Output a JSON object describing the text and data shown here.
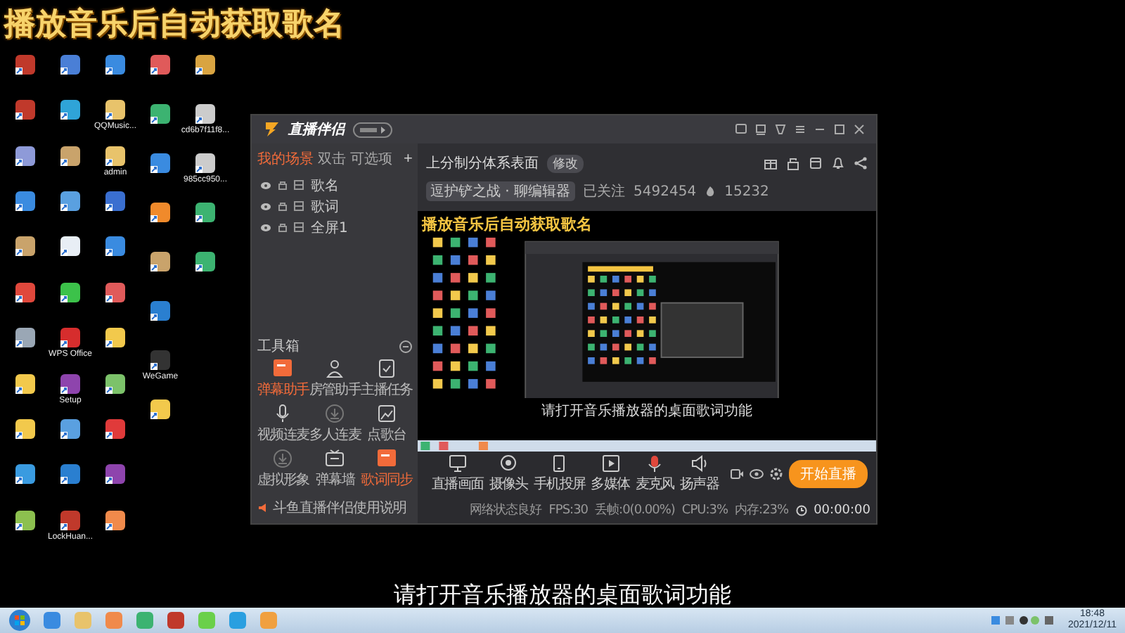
{
  "overlay_title": "播放音乐后自动获取歌名",
  "desktop_columns": [
    [
      {
        "color": "#c0392b"
      },
      {
        "color": "#c0392b"
      },
      {
        "color": "#8e9ad8"
      },
      {
        "color": "#3a8be0"
      },
      {
        "color": "#c9a36b"
      },
      {
        "color": "#e0483c"
      },
      {
        "color": "#9aa7b5"
      },
      {
        "color": "#f2c94c"
      },
      {
        "color": "#f2c94c"
      },
      {
        "color": "#3a9be0"
      },
      {
        "color": "#8cc04f"
      }
    ],
    [
      {
        "color": "#4a7fd6"
      },
      {
        "color": "#2fa4d8"
      },
      {
        "color": "#c9a36b"
      },
      {
        "color": "#5aa0e0"
      },
      {
        "color": "#e8eef5"
      },
      {
        "color": "#3cc24a"
      },
      {
        "color": "#d62d2d",
        "label": "WPS Office"
      },
      {
        "color": "#8e44ad",
        "label": "Setup"
      },
      {
        "color": "#5aa0e0"
      },
      {
        "color": "#2a7fd0"
      },
      {
        "color": "#c0392b",
        "label": "LockHuan..."
      }
    ],
    [
      {
        "color": "#3a8be0"
      },
      {
        "color": "#e8c36b",
        "label": "QQMusic..."
      },
      {
        "color": "#e8c36b",
        "label": "admin"
      },
      {
        "color": "#3a6fd0"
      },
      {
        "color": "#3a8be0"
      },
      {
        "color": "#e05a5a"
      },
      {
        "color": "#f2c94c"
      },
      {
        "color": "#7cc26a"
      },
      {
        "color": "#e03a3a"
      },
      {
        "color": "#8e44ad"
      },
      {
        "color": "#f08a4b"
      }
    ],
    [
      {
        "color": "#e05a5a"
      },
      {
        "color": "#3cb371"
      },
      {
        "color": "#3a8be0"
      },
      {
        "color": "#f08a2b"
      },
      {
        "color": "#c9a36b"
      },
      {
        "color": "#2a7fd0"
      },
      {
        "color": "#333333",
        "label": "WeGame"
      },
      {
        "color": "#f2c94c"
      }
    ],
    [
      {
        "color": "#d9a441"
      },
      {
        "color": "#cccccc",
        "label": "cd6b7f11f8..."
      },
      {
        "color": "#cccccc",
        "label": "985cc950..."
      },
      {
        "color": "#3cb371"
      },
      {
        "color": "#3cb371"
      }
    ]
  ],
  "window": {
    "logo": "直播伴侣",
    "scene_tabs": [
      {
        "label": "我的场景",
        "selected": true
      },
      {
        "label": "双击",
        "selected": false
      },
      {
        "label": "可选项",
        "selected": false
      }
    ],
    "add_button": "+",
    "scenes": [
      {
        "label": "歌名"
      },
      {
        "label": "歌词"
      },
      {
        "label": "全屏1"
      }
    ],
    "toolbox_title": "工具箱",
    "tools": [
      {
        "label": "弹幕助手",
        "kind": "screen",
        "highlight": true
      },
      {
        "label": "房管助手",
        "kind": "person",
        "highlight": false
      },
      {
        "label": "主播任务",
        "kind": "clipboard",
        "highlight": false
      },
      {
        "label": "视频连麦",
        "kind": "mic",
        "highlight": false
      },
      {
        "label": "多人连麦",
        "kind": "download",
        "highlight": false
      },
      {
        "label": "点歌台",
        "kind": "image",
        "highlight": false
      },
      {
        "label": "虚拟形象",
        "kind": "download",
        "highlight": false
      },
      {
        "label": "弹幕墙",
        "kind": "tv",
        "highlight": false
      },
      {
        "label": "歌词同步",
        "kind": "screen",
        "highlight": true
      }
    ],
    "notice": "斗鱼直播伴侣使用说明",
    "room_title": "上分制分体系表面",
    "room_edit": "修改",
    "room_tag": "逗护铲之战 · 聊编辑器",
    "followers_label": "已关注",
    "followers": "5492454",
    "hot": "15232",
    "preview": {
      "title": "播放音乐后自动获取歌名",
      "caption": "请打开音乐播放器的桌面歌词功能"
    },
    "controls": [
      {
        "label": "直播画面",
        "kind": "screen"
      },
      {
        "label": "摄像头",
        "kind": "camera"
      },
      {
        "label": "手机投屏",
        "kind": "phone"
      },
      {
        "label": "多媒体",
        "kind": "media"
      },
      {
        "label": "麦克风",
        "kind": "mic"
      },
      {
        "label": "扬声器",
        "kind": "speaker"
      }
    ],
    "start_button": "开始直播",
    "status": [
      "网络状态良好",
      "FPS:30",
      "丢帧:0(0.00%)",
      "CPU:3%",
      "内存:23%"
    ],
    "timer": "00:00:00"
  },
  "caption": "请打开音乐播放器的桌面歌词功能",
  "taskbar": {
    "apps": [
      {
        "color": "#3a8be0"
      },
      {
        "color": "#e8c36b"
      },
      {
        "color": "#f08a4b"
      },
      {
        "color": "#3cb371"
      },
      {
        "color": "#c0392b"
      },
      {
        "color": "#6ad04a"
      },
      {
        "color": "#2a9fe0"
      },
      {
        "color": "#f0a040"
      }
    ],
    "time": "18:48",
    "date": "2021/12/11"
  }
}
